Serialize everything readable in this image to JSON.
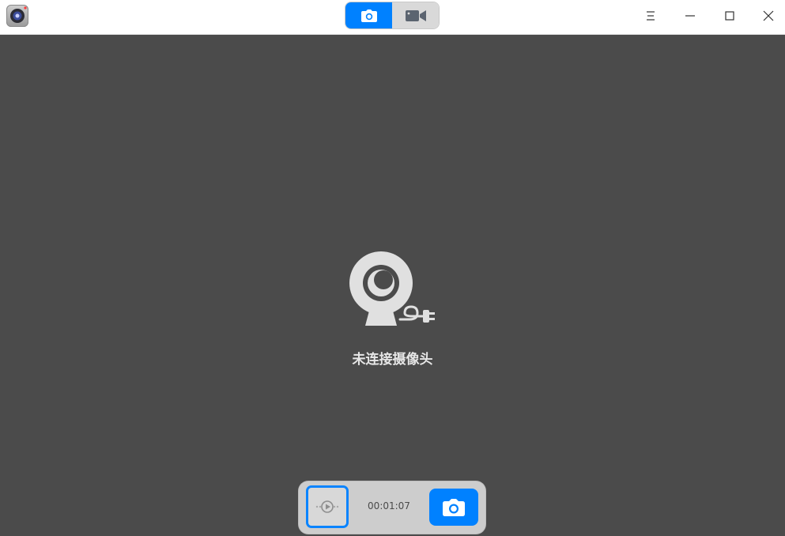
{
  "titlebar": {
    "app_icon": "camera-app-icon",
    "modes": [
      {
        "name": "photo-mode",
        "icon": "camera-icon",
        "active": true
      },
      {
        "name": "video-mode",
        "icon": "video-camera-icon",
        "active": false
      }
    ],
    "window_controls": [
      "menu-icon",
      "minimize-icon",
      "maximize-icon",
      "close-icon"
    ]
  },
  "main": {
    "status_icon": "webcam-unplugged-icon",
    "status_text": "未连接摄像头"
  },
  "controls": {
    "thumbnail_icon": "video-thumbnail-icon",
    "duration": "00:01:07",
    "shutter_icon": "camera-icon"
  },
  "colors": {
    "accent": "#0081ff",
    "background": "#4b4b4b",
    "titlebar": "#ffffff"
  }
}
